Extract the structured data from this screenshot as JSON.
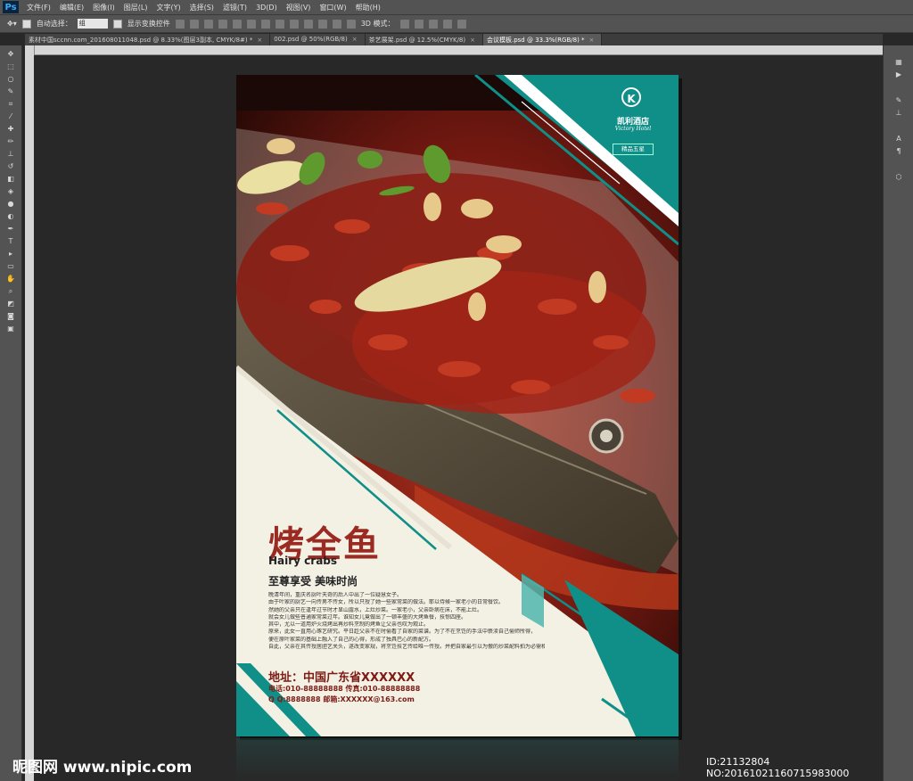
{
  "app": {
    "logo": "Ps",
    "menu": [
      "文件(F)",
      "编辑(E)",
      "图像(I)",
      "图层(L)",
      "文字(Y)",
      "选择(S)",
      "滤镜(T)",
      "3D(D)",
      "视图(V)",
      "窗口(W)",
      "帮助(H)"
    ]
  },
  "options": {
    "auto_select_label": "自动选择：",
    "auto_select_value": "组",
    "show_transform_label": "显示变换控件",
    "mode_3d_label": "3D 模式："
  },
  "tabs": [
    {
      "label": "素材中国sccnn.com_201608011048.psd @ 8.33%(图层3副本, CMYK/8#) *"
    },
    {
      "label": "002.psd @ 50%(RGB/8)"
    },
    {
      "label": "茶艺展架.psd @ 12.5%(CMYK/8)"
    },
    {
      "label": "会议模板.psd @ 33.3%(RGB/8) *"
    }
  ],
  "poster": {
    "hotel_name_cn": "凯利酒店",
    "hotel_name_en": "Victory Hotel",
    "logo_letter": "K",
    "badge": "精品五星",
    "title_cn": "烤全鱼",
    "title_en": "Hairy crabs",
    "slogan": "至尊享受 美味时尚",
    "body_lines": [
      "晚清年间，重庆名厨叶天奇的后人中出了一位疑慧女子。",
      "由于叶家的厨艺一向传男不传女，所以只授了她一些家常菜的做法。耶以侍候一家老小的日常餐饮。",
      "然她的父亲只在逢年过节时才显山露水，上灶炒菜。一家老小，父亲卧病在床，不能上灶。",
      "就会女儿做些普通家常菜过年。谁知女儿竟做出了一顿丰盛的大烤鱼餐，技惊四座。",
      "其中，尤以一道用炉火烧烤出再炒料烹制的烤鱼让父亲也叹为观止。",
      "原来，此女一直用心琢艺研究。平日趁父亲不在时偷看了自家的菜谱。为了不在烹饪的手法中亵渎自己偷师所得，",
      "便在原叶家菜的基础上融入了自己的心得，形成了独具巴心的新配方。",
      "自此，父亲在其传授居胆艺关头，遂改变家规，将烹饪技艺传给唯一传授。并把自家最引以为傲的炒菜配料拍为必需相授"
    ],
    "address": "地址：中国广东省XXXXXX",
    "phone": "电话:010-88888888  传真:010-88888888",
    "qq_email": "Q Q:8888888  邮箱:XXXXXX@163.com"
  },
  "watermark": {
    "left": "昵图网 www.nipic.com",
    "right": "ID:21132804 NO:20161021160715983000"
  },
  "colors": {
    "teal": "#0f8f87",
    "title_red": "#9b2a22",
    "cream": "#f3f0e4"
  }
}
